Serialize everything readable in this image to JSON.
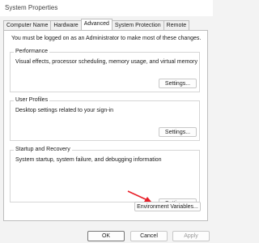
{
  "window": {
    "title": "System Properties"
  },
  "tabs": [
    "Computer Name",
    "Hardware",
    "Advanced",
    "System Protection",
    "Remote"
  ],
  "advanced": {
    "admin_note": "You must be logged on as an Administrator to make most of these changes.",
    "performance": {
      "title": "Performance",
      "description": "Visual effects, processor scheduling, memory usage, and virtual memory",
      "button": "Settings..."
    },
    "user_profiles": {
      "title": "User Profiles",
      "description": "Desktop settings related to your sign-in",
      "button": "Settings..."
    },
    "startup_recovery": {
      "title": "Startup and Recovery",
      "description": "System startup, system failure, and debugging information",
      "button": "Settings..."
    },
    "env_button": "Environment Variables..."
  },
  "footer": {
    "ok": "OK",
    "cancel": "Cancel",
    "apply": "Apply"
  },
  "colors": {
    "arrow": "#e8202a"
  }
}
